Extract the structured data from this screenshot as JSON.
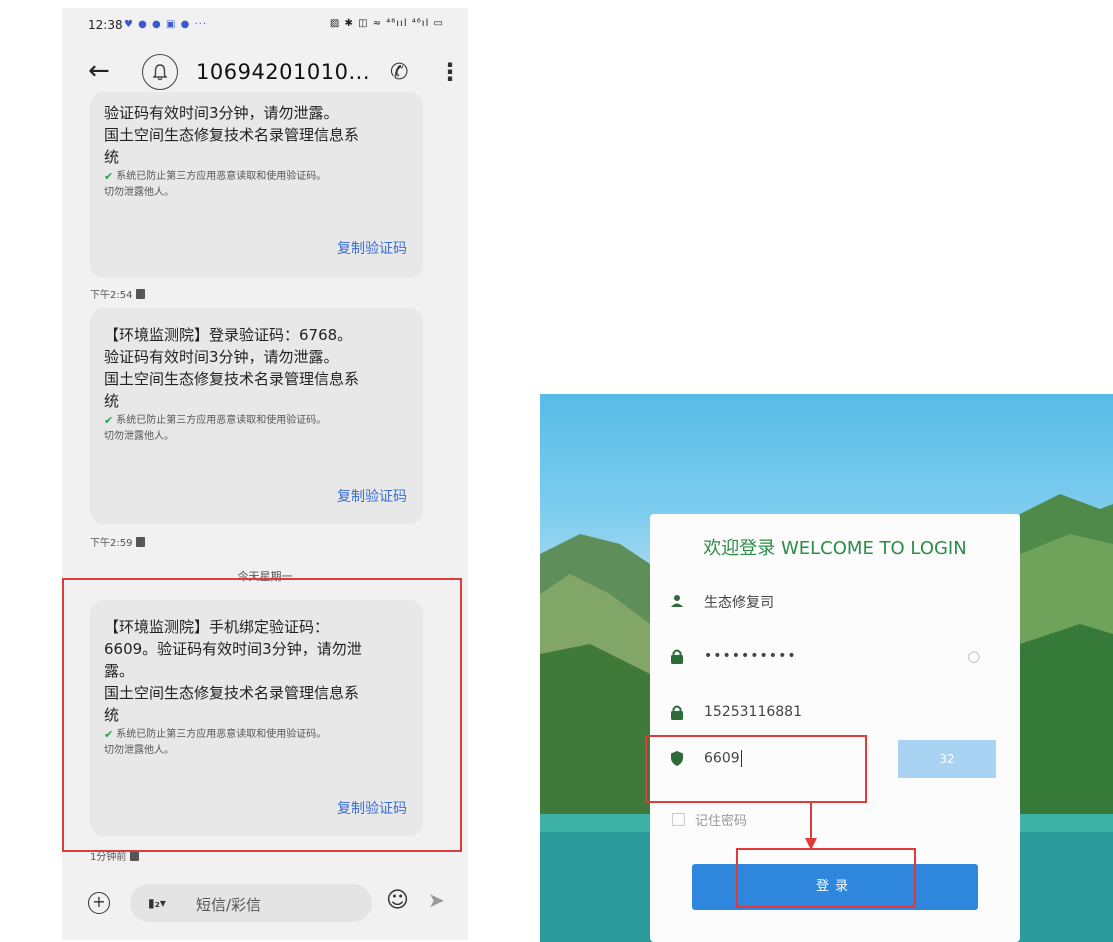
{
  "phone": {
    "status": {
      "time": "12:38",
      "notification_icons": "♥ ● ● ▣ ● ···",
      "right_icons": "▨ ✱ ◫ ≈ ⁴⁶ııl ⁴⁶ıl ▭"
    },
    "header": {
      "sender": "10694201010...",
      "icons": [
        "back-arrow-icon",
        "bell-icon",
        "phone-call-icon",
        "more-vertical-icon"
      ]
    },
    "messages": [
      {
        "text": "验证码有效时间3分钟，请勿泄露。\n国土空间生态修复技术名录管理信息系\n统",
        "secure_line1": "系统已防止第三方应用恶意读取和使用验证码。",
        "secure_line2": "切勿泄露他人。",
        "copy_label": "复制验证码",
        "time": "下午2:54"
      },
      {
        "text": "【环境监测院】登录验证码：6768。\n验证码有效时间3分钟，请勿泄露。\n国土空间生态修复技术名录管理信息系\n统",
        "secure_line1": "系统已防止第三方应用恶意读取和使用验证码。",
        "secure_line2": "切勿泄露他人。",
        "copy_label": "复制验证码",
        "time": "下午2:59"
      },
      {
        "text": "【环境监测院】手机绑定验证码：\n6609。验证码有效时间3分钟，请勿泄\n露。\n国土空间生态修复技术名录管理信息系\n统",
        "secure_line1": "系统已防止第三方应用恶意读取和使用验证码。",
        "secure_line2": "切勿泄露他人。",
        "copy_label": "复制验证码",
        "time": "1分钟前"
      }
    ],
    "date_divider": "今天星期一",
    "input": {
      "placeholder": "短信/彩信",
      "sim_label": "▮₂▾"
    }
  },
  "login": {
    "title": "欢迎登录 WELCOME TO LOGIN",
    "username": "生态修复司",
    "password_mask": "••••••••••",
    "phone_number": "15253116881",
    "verify_code": "6609",
    "countdown": "32",
    "remember_label": "记住密码",
    "login_button": "登录"
  },
  "colors": {
    "annotation_red": "#e03a3a",
    "link_blue": "#3b6fd3",
    "title_green": "#2d8c46",
    "button_blue": "#2f87dd",
    "code_button": "#a9d3f2"
  }
}
